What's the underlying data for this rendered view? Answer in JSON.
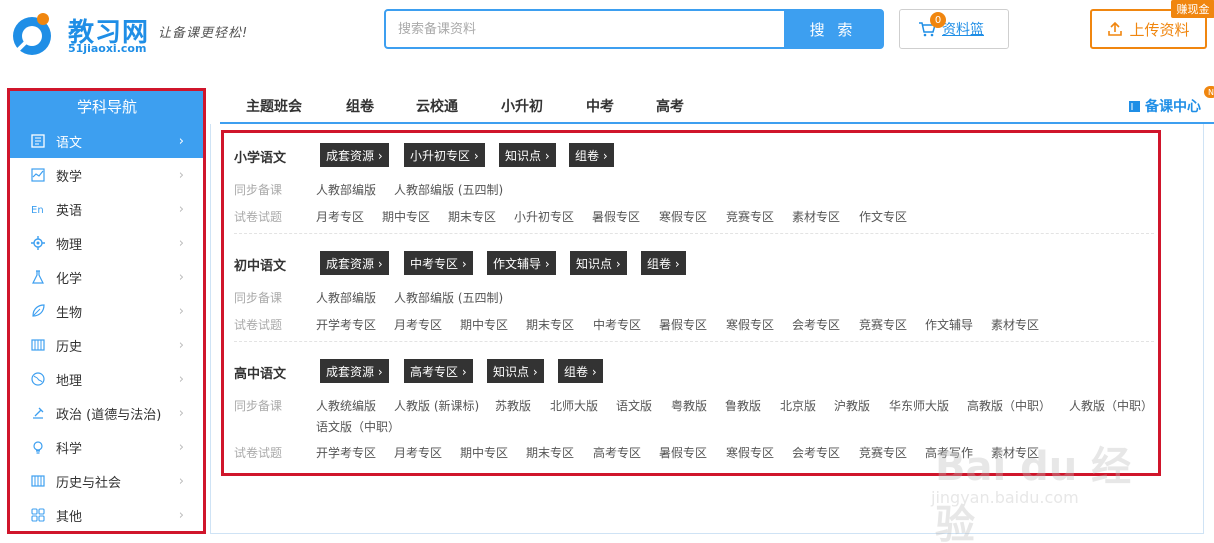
{
  "header": {
    "logo_name": "教习网",
    "logo_domain": "51jiaoxi.com",
    "slogan": "让备课更轻松!",
    "search_placeholder": "搜索备课资料",
    "search_button": "搜 索",
    "basket_label": "资料篮",
    "basket_count": "0",
    "upload_label": "上传资料",
    "earn_tag": "赚现金"
  },
  "sidebar": {
    "title": "学科导航",
    "items": [
      {
        "label": "语文",
        "icon": "book-icon"
      },
      {
        "label": "数学",
        "icon": "chart-icon"
      },
      {
        "label": "英语",
        "icon": "english-icon"
      },
      {
        "label": "物理",
        "icon": "gear-icon"
      },
      {
        "label": "化学",
        "icon": "flask-icon"
      },
      {
        "label": "生物",
        "icon": "leaf-icon"
      },
      {
        "label": "历史",
        "icon": "scroll-icon"
      },
      {
        "label": "地理",
        "icon": "globe-icon"
      },
      {
        "label": "政治 (道德与法治)",
        "icon": "law-icon"
      },
      {
        "label": "科学",
        "icon": "bulb-icon"
      },
      {
        "label": "历史与社会",
        "icon": "scroll-icon"
      },
      {
        "label": "其他",
        "icon": "grid-icon"
      }
    ],
    "chevron": "›"
  },
  "topnav": {
    "items": [
      "主题班会",
      "组卷",
      "云校通",
      "小升初",
      "中考",
      "高考"
    ],
    "lesson_center": "备课中心",
    "new_badge": "N"
  },
  "sections": [
    {
      "title": "小学语文",
      "tags": [
        "成套资源 ›",
        "小升初专区 ›",
        "知识点 ›",
        "组卷 ›"
      ],
      "rows": [
        {
          "label": "同步备课",
          "links": [
            "人教部编版",
            "人教部编版 (五四制)"
          ]
        },
        {
          "label": "试卷试题",
          "links": [
            "月考专区",
            "期中专区",
            "期末专区",
            "小升初专区",
            "暑假专区",
            "寒假专区",
            "竞赛专区",
            "素材专区",
            "作文专区"
          ]
        }
      ]
    },
    {
      "title": "初中语文",
      "tags": [
        "成套资源 ›",
        "中考专区 ›",
        "作文辅导 ›",
        "知识点 ›",
        "组卷 ›"
      ],
      "rows": [
        {
          "label": "同步备课",
          "links": [
            "人教部编版",
            "人教部编版 (五四制)"
          ]
        },
        {
          "label": "试卷试题",
          "links": [
            "开学考专区",
            "月考专区",
            "期中专区",
            "期末专区",
            "中考专区",
            "暑假专区",
            "寒假专区",
            "会考专区",
            "竞赛专区",
            "作文辅导",
            "素材专区"
          ]
        }
      ]
    },
    {
      "title": "高中语文",
      "tags": [
        "成套资源 ›",
        "高考专区 ›",
        "知识点 ›",
        "组卷 ›"
      ],
      "rows": [
        {
          "label": "同步备课",
          "links": [
            "人教统编版",
            "人教版 (新课标)",
            "苏教版",
            "北师大版",
            "语文版",
            "粤教版",
            "鲁教版",
            "北京版",
            "沪教版",
            "华东师大版",
            "高教版（中职）",
            "人教版（中职）",
            "语文版（中职）"
          ]
        },
        {
          "label": "试卷试题",
          "links": [
            "开学考专区",
            "月考专区",
            "期中专区",
            "期末专区",
            "高考专区",
            "暑假专区",
            "寒假专区",
            "会考专区",
            "竞赛专区",
            "高考写作",
            "素材专区"
          ]
        }
      ]
    }
  ],
  "watermark": {
    "text": "Bai du 经验",
    "url": "jingyan.baidu.com"
  },
  "colors": {
    "accent": "#3d9ff0",
    "orange": "#f0860f",
    "highlight_box": "#d0152b"
  }
}
